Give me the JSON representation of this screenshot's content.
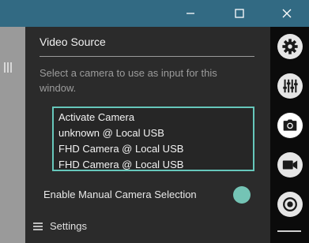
{
  "panel": {
    "section_title": "Video Source",
    "description": "Select a camera to use as input for this window.",
    "camera_list": [
      "Activate Camera",
      "unknown @ Local USB",
      "FHD Camera @ Local USB",
      "FHD Camera @ Local USB"
    ],
    "toggle_label": "Enable Manual Camera Selection",
    "toggle_on": true,
    "settings_label": "Settings"
  },
  "toolbar": {
    "items": [
      "gear-icon",
      "sliders-icon",
      "camera-icon",
      "video-icon",
      "record-icon"
    ],
    "active": "camera-icon"
  },
  "colors": {
    "titlebar": "#326a83",
    "accent": "#66c7bb",
    "toggle": "#74c4b5",
    "panel_bg": "#2b2b2b",
    "toolbar_bg": "#0b0b0b"
  }
}
